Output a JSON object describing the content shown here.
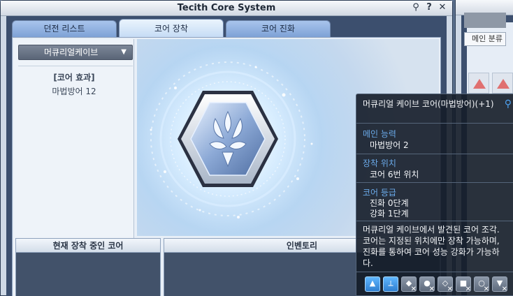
{
  "window": {
    "title": "Tecith Core System",
    "buttons": {
      "pin": "⚲",
      "help": "?",
      "close": "✕"
    }
  },
  "tabs": [
    {
      "label": "던전 리스트"
    },
    {
      "label": "코어 장착",
      "active": true
    },
    {
      "label": "코어 진화"
    }
  ],
  "left": {
    "dropdown": "머큐리얼케이브",
    "effect_header": "[코어 효과]",
    "effect_value": "마법방어 12"
  },
  "panels": {
    "equipped": "현재 장착 중인 코어",
    "inventory": "인벤토리"
  },
  "right_window": {
    "label": "메인 분류"
  },
  "tooltip": {
    "title": "머큐리얼 케이브 코어(마법방어)(+1)",
    "sections": [
      {
        "label": "메인 능력",
        "values": [
          "마법방어 2"
        ]
      },
      {
        "label": "장착 위치",
        "values": [
          "코어 6번 위치"
        ]
      },
      {
        "label": "코어 등급",
        "values": [
          "진화 0단계",
          "강화 1단계"
        ]
      }
    ],
    "description": "머큐리얼 케이브에서 발견된 코어 조각. 코어는 지정된 위치에만 장착 가능하며, 진화를 통하여 코어 성능 강화가 가능하다.",
    "icons": [
      "boot-icon",
      "sword-icon",
      "armor-icon",
      "shield-icon",
      "gem-icon",
      "bag-icon",
      "ring-icon",
      "helm-icon"
    ]
  },
  "colors": {
    "window_frame": "#3c4f6e",
    "tab_active": "#eaf4fd",
    "tooltip_label": "#6aa9e8",
    "tooltip_bg": "#141c28"
  }
}
